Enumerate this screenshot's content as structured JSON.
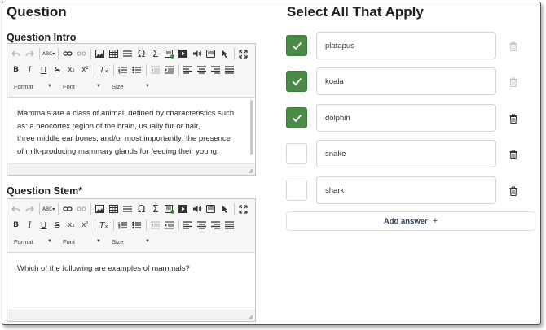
{
  "left": {
    "heading": "Question",
    "intro_label": "Question Intro",
    "stem_label": "Question Stem*",
    "intro_lines": [
      "Mammals are a class of animal, defined by characteristics such",
      "as: a neocortex region of the brain, usually fur or hair,",
      "three middle ear bones, and/or most importantly: the presence",
      "of milk-producing mammary glands for feeding their young."
    ],
    "stem_text": "Which of the following are examples of mammals?"
  },
  "toolbar": {
    "format_label": "Format",
    "font_label": "Font",
    "size_label": "Size",
    "bold": "B",
    "italic": "I",
    "underline": "U",
    "strike": "S",
    "subscript": "x₂",
    "superscript": "x²",
    "remove_format": "Tₓ",
    "special_char": "Ω",
    "sigma": "Σ",
    "spell": "ABC"
  },
  "right": {
    "heading": "Select All That Apply",
    "add_answer_label": "Add answer",
    "add_answer_icon": "+",
    "answers": [
      {
        "text": "platapus",
        "checked": true,
        "trash_active": false
      },
      {
        "text": "koala",
        "checked": true,
        "trash_active": false
      },
      {
        "text": "dolphin",
        "checked": true,
        "trash_active": true
      },
      {
        "text": "snake",
        "checked": false,
        "trash_active": true
      },
      {
        "text": "shark",
        "checked": false,
        "trash_active": true
      }
    ]
  },
  "colors": {
    "check_on": "#4a8b47",
    "trash_active": "#333333",
    "trash_inactive": "#c4c4c4"
  }
}
